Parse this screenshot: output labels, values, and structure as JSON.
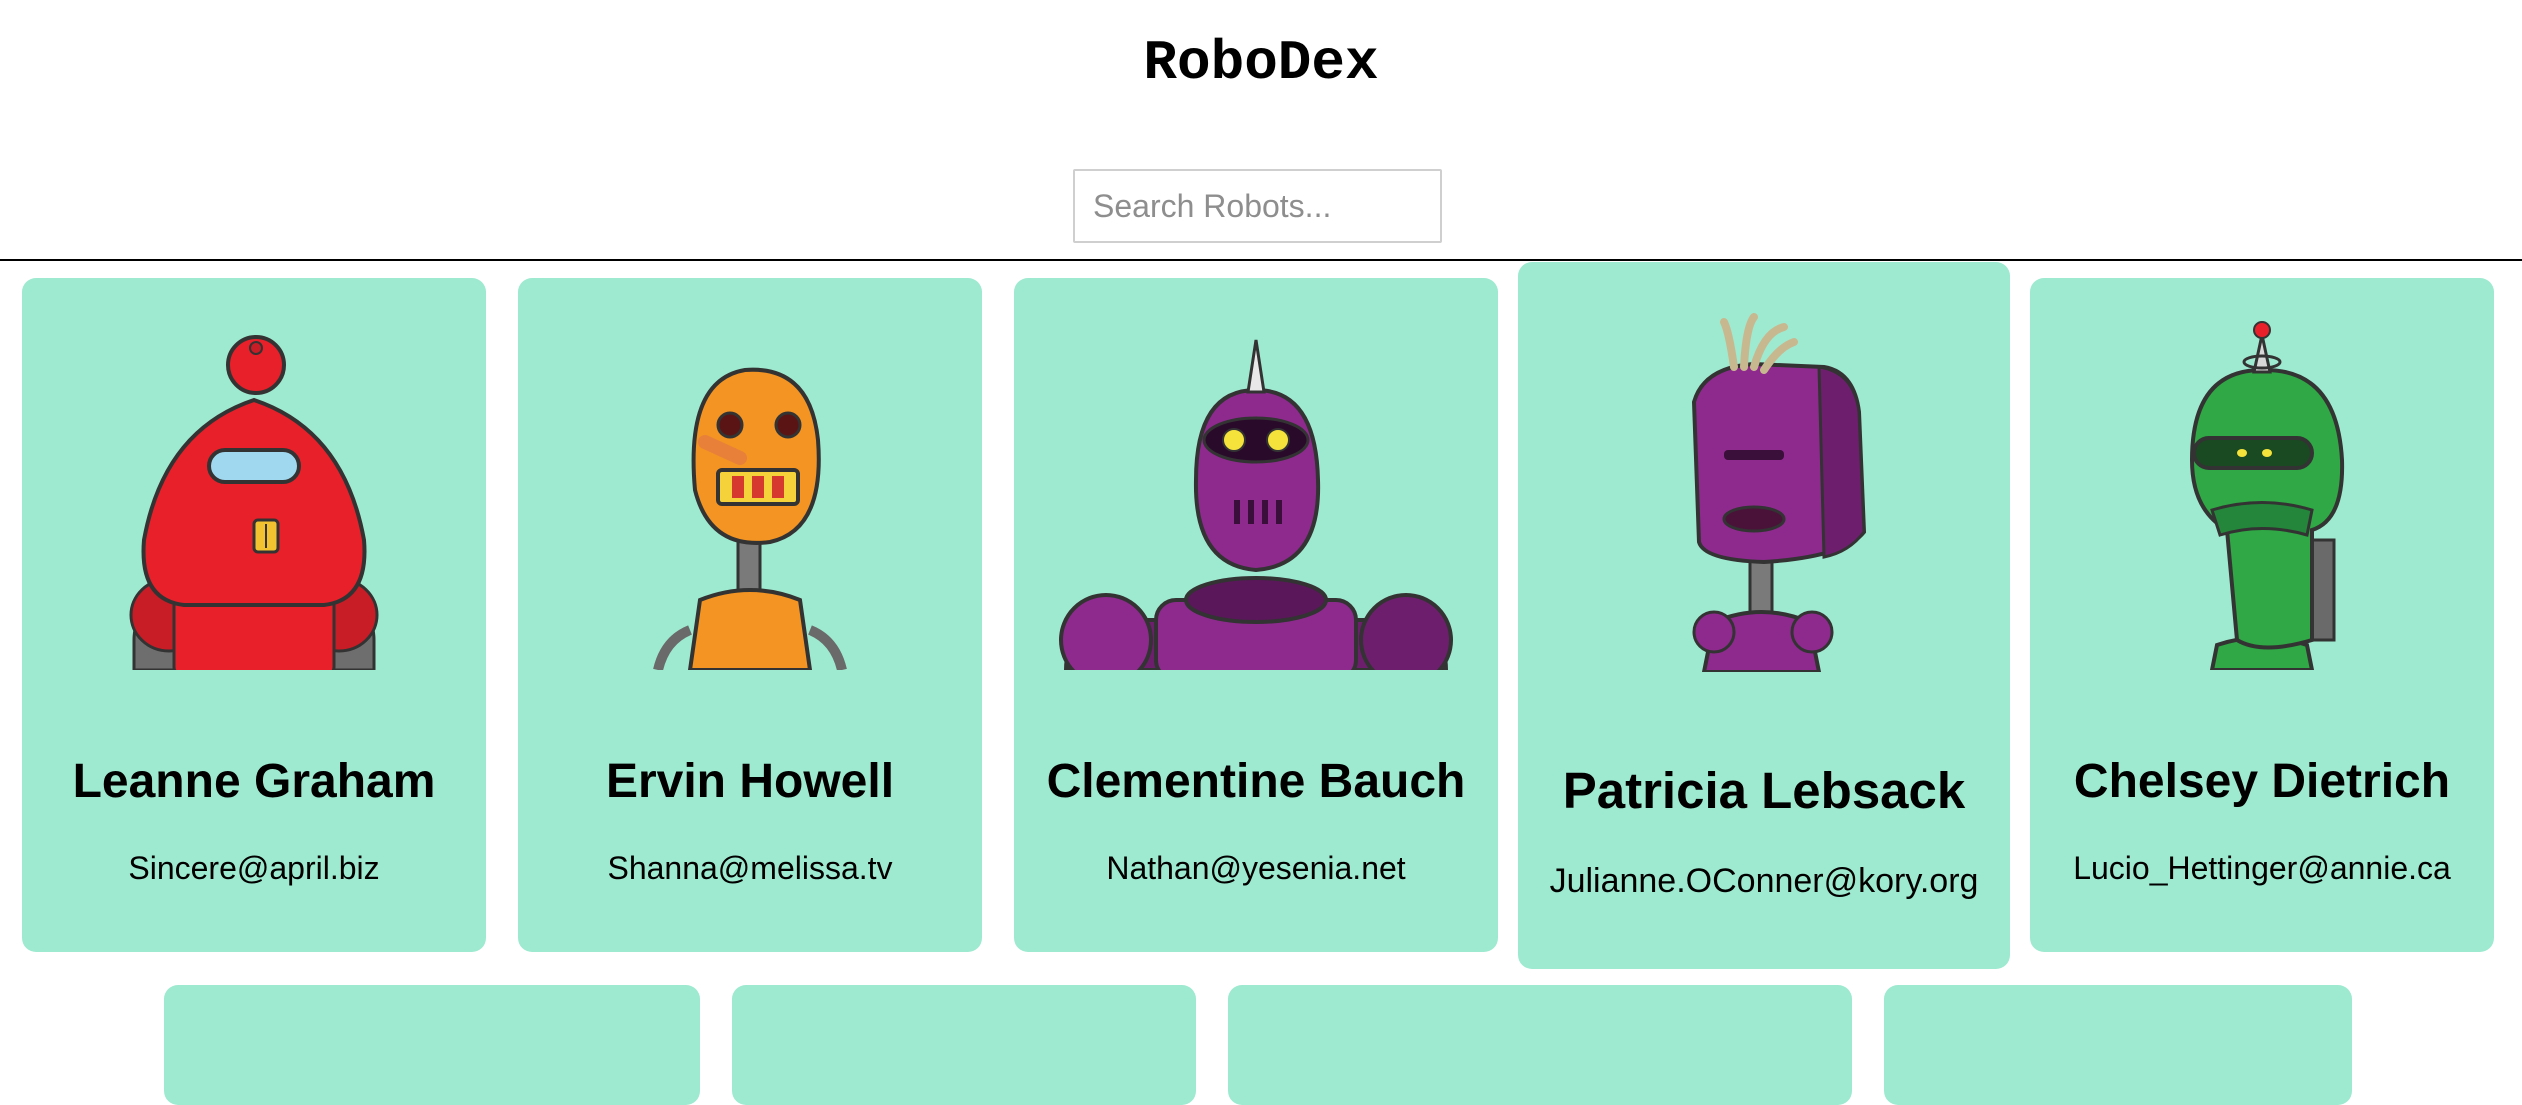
{
  "header": {
    "title": "RoboDex"
  },
  "search": {
    "placeholder": "Search Robots..."
  },
  "robots": [
    {
      "name": "Leanne Graham",
      "email": "Sincere@april.biz",
      "color": "#e8202a"
    },
    {
      "name": "Ervin Howell",
      "email": "Shanna@melissa.tv",
      "color": "#f39423"
    },
    {
      "name": "Clementine Bauch",
      "email": "Nathan@yesenia.net",
      "color": "#8e2a8e"
    },
    {
      "name": "Patricia Lebsack",
      "email": "Julianne.OConner@kory.org",
      "color": "#8e2a8e"
    },
    {
      "name": "Chelsey Dietrich",
      "email": "Lucio_Hettinger@annie.ca",
      "color": "#2fa845"
    }
  ],
  "theme": {
    "card_background": "#9eead0",
    "divider": "#000000"
  }
}
